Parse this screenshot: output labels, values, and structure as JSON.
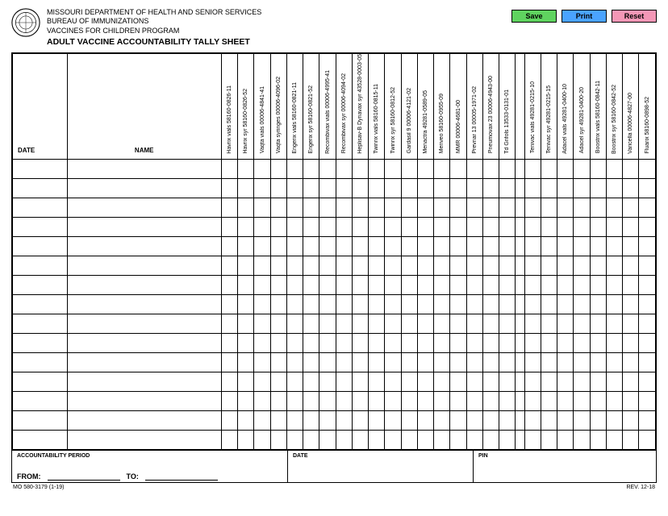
{
  "header": {
    "dept": "MISSOURI DEPARTMENT OF HEALTH AND SENIOR SERVICES",
    "bureau": "BUREAU OF IMMUNIZATIONS",
    "program": "VACCINES FOR CHILDREN PROGRAM",
    "title": "ADULT VACCINE ACCOUNTABILITY TALLY SHEET"
  },
  "buttons": {
    "save": "Save",
    "print": "Print",
    "reset": "Reset"
  },
  "columns": {
    "date": "DATE",
    "name": "NAME",
    "vaccines_group1": [
      "Havrix vials 58160-0826-11",
      "Havrix syr 58160-0826-52",
      "Vaqta vials 00006-4841-41",
      "Vaqta syringes 00006-4096-02",
      "Engerix vials 58160-0821-11",
      "Engerix syr 58160-0821-52",
      "Recombivax vials 00006-4995-41",
      "Recombivax syr 00006-4094-02",
      "Heplisav-B Dynavax syr 43528-0003-05",
      "Twinrix vials 58160-0815-11",
      "Twinrix syr 58160-0812-52",
      "Gardasil 9 00006-4121-02",
      "Menactra 49281-0589-05",
      "Menveo 58160-0955-09",
      "MMR 00006-4681-00",
      "Prevnar 13 00005-1971-02",
      "Pneumovax 23 00006-4943-00",
      "Td Grifols 13533-0131-01"
    ],
    "vaccines_group2": [
      "Tenivac vials 49281-0215-10",
      "Tenivac syr 49281-0215-15",
      "Adacel vials 49281-0400-10",
      "Adacel syr 49281-0400-20",
      "Boostrix vials 58160-0842-11",
      "Boostrix syr 58160-0842-52",
      "Varicella 00006-4827-00",
      "Fluarix 58160-0898-52"
    ]
  },
  "row_count": 15,
  "footer": {
    "period_label": "ACCOUNTABILITY PERIOD",
    "date_label": "DATE",
    "pin_label": "PIN",
    "from": "FROM:",
    "to": "TO:"
  },
  "form_id": "MO 580-3179 (1-19)",
  "rev": "REV. 12-18"
}
